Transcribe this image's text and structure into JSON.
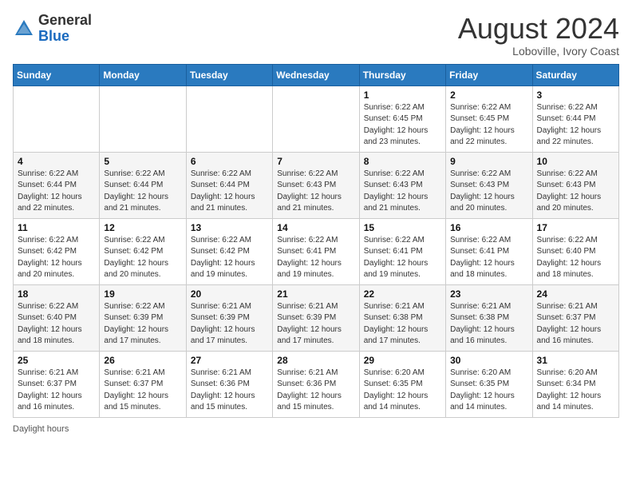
{
  "header": {
    "logo_general": "General",
    "logo_blue": "Blue",
    "month_year": "August 2024",
    "location": "Loboville, Ivory Coast"
  },
  "days_of_week": [
    "Sunday",
    "Monday",
    "Tuesday",
    "Wednesday",
    "Thursday",
    "Friday",
    "Saturday"
  ],
  "weeks": [
    [
      {
        "day": "",
        "detail": ""
      },
      {
        "day": "",
        "detail": ""
      },
      {
        "day": "",
        "detail": ""
      },
      {
        "day": "",
        "detail": ""
      },
      {
        "day": "1",
        "detail": "Sunrise: 6:22 AM\nSunset: 6:45 PM\nDaylight: 12 hours\nand 23 minutes."
      },
      {
        "day": "2",
        "detail": "Sunrise: 6:22 AM\nSunset: 6:45 PM\nDaylight: 12 hours\nand 22 minutes."
      },
      {
        "day": "3",
        "detail": "Sunrise: 6:22 AM\nSunset: 6:44 PM\nDaylight: 12 hours\nand 22 minutes."
      }
    ],
    [
      {
        "day": "4",
        "detail": "Sunrise: 6:22 AM\nSunset: 6:44 PM\nDaylight: 12 hours\nand 22 minutes."
      },
      {
        "day": "5",
        "detail": "Sunrise: 6:22 AM\nSunset: 6:44 PM\nDaylight: 12 hours\nand 21 minutes."
      },
      {
        "day": "6",
        "detail": "Sunrise: 6:22 AM\nSunset: 6:44 PM\nDaylight: 12 hours\nand 21 minutes."
      },
      {
        "day": "7",
        "detail": "Sunrise: 6:22 AM\nSunset: 6:43 PM\nDaylight: 12 hours\nand 21 minutes."
      },
      {
        "day": "8",
        "detail": "Sunrise: 6:22 AM\nSunset: 6:43 PM\nDaylight: 12 hours\nand 21 minutes."
      },
      {
        "day": "9",
        "detail": "Sunrise: 6:22 AM\nSunset: 6:43 PM\nDaylight: 12 hours\nand 20 minutes."
      },
      {
        "day": "10",
        "detail": "Sunrise: 6:22 AM\nSunset: 6:43 PM\nDaylight: 12 hours\nand 20 minutes."
      }
    ],
    [
      {
        "day": "11",
        "detail": "Sunrise: 6:22 AM\nSunset: 6:42 PM\nDaylight: 12 hours\nand 20 minutes."
      },
      {
        "day": "12",
        "detail": "Sunrise: 6:22 AM\nSunset: 6:42 PM\nDaylight: 12 hours\nand 20 minutes."
      },
      {
        "day": "13",
        "detail": "Sunrise: 6:22 AM\nSunset: 6:42 PM\nDaylight: 12 hours\nand 19 minutes."
      },
      {
        "day": "14",
        "detail": "Sunrise: 6:22 AM\nSunset: 6:41 PM\nDaylight: 12 hours\nand 19 minutes."
      },
      {
        "day": "15",
        "detail": "Sunrise: 6:22 AM\nSunset: 6:41 PM\nDaylight: 12 hours\nand 19 minutes."
      },
      {
        "day": "16",
        "detail": "Sunrise: 6:22 AM\nSunset: 6:41 PM\nDaylight: 12 hours\nand 18 minutes."
      },
      {
        "day": "17",
        "detail": "Sunrise: 6:22 AM\nSunset: 6:40 PM\nDaylight: 12 hours\nand 18 minutes."
      }
    ],
    [
      {
        "day": "18",
        "detail": "Sunrise: 6:22 AM\nSunset: 6:40 PM\nDaylight: 12 hours\nand 18 minutes."
      },
      {
        "day": "19",
        "detail": "Sunrise: 6:22 AM\nSunset: 6:39 PM\nDaylight: 12 hours\nand 17 minutes."
      },
      {
        "day": "20",
        "detail": "Sunrise: 6:21 AM\nSunset: 6:39 PM\nDaylight: 12 hours\nand 17 minutes."
      },
      {
        "day": "21",
        "detail": "Sunrise: 6:21 AM\nSunset: 6:39 PM\nDaylight: 12 hours\nand 17 minutes."
      },
      {
        "day": "22",
        "detail": "Sunrise: 6:21 AM\nSunset: 6:38 PM\nDaylight: 12 hours\nand 17 minutes."
      },
      {
        "day": "23",
        "detail": "Sunrise: 6:21 AM\nSunset: 6:38 PM\nDaylight: 12 hours\nand 16 minutes."
      },
      {
        "day": "24",
        "detail": "Sunrise: 6:21 AM\nSunset: 6:37 PM\nDaylight: 12 hours\nand 16 minutes."
      }
    ],
    [
      {
        "day": "25",
        "detail": "Sunrise: 6:21 AM\nSunset: 6:37 PM\nDaylight: 12 hours\nand 16 minutes."
      },
      {
        "day": "26",
        "detail": "Sunrise: 6:21 AM\nSunset: 6:37 PM\nDaylight: 12 hours\nand 15 minutes."
      },
      {
        "day": "27",
        "detail": "Sunrise: 6:21 AM\nSunset: 6:36 PM\nDaylight: 12 hours\nand 15 minutes."
      },
      {
        "day": "28",
        "detail": "Sunrise: 6:21 AM\nSunset: 6:36 PM\nDaylight: 12 hours\nand 15 minutes."
      },
      {
        "day": "29",
        "detail": "Sunrise: 6:20 AM\nSunset: 6:35 PM\nDaylight: 12 hours\nand 14 minutes."
      },
      {
        "day": "30",
        "detail": "Sunrise: 6:20 AM\nSunset: 6:35 PM\nDaylight: 12 hours\nand 14 minutes."
      },
      {
        "day": "31",
        "detail": "Sunrise: 6:20 AM\nSunset: 6:34 PM\nDaylight: 12 hours\nand 14 minutes."
      }
    ]
  ],
  "footer": {
    "note": "Daylight hours"
  }
}
